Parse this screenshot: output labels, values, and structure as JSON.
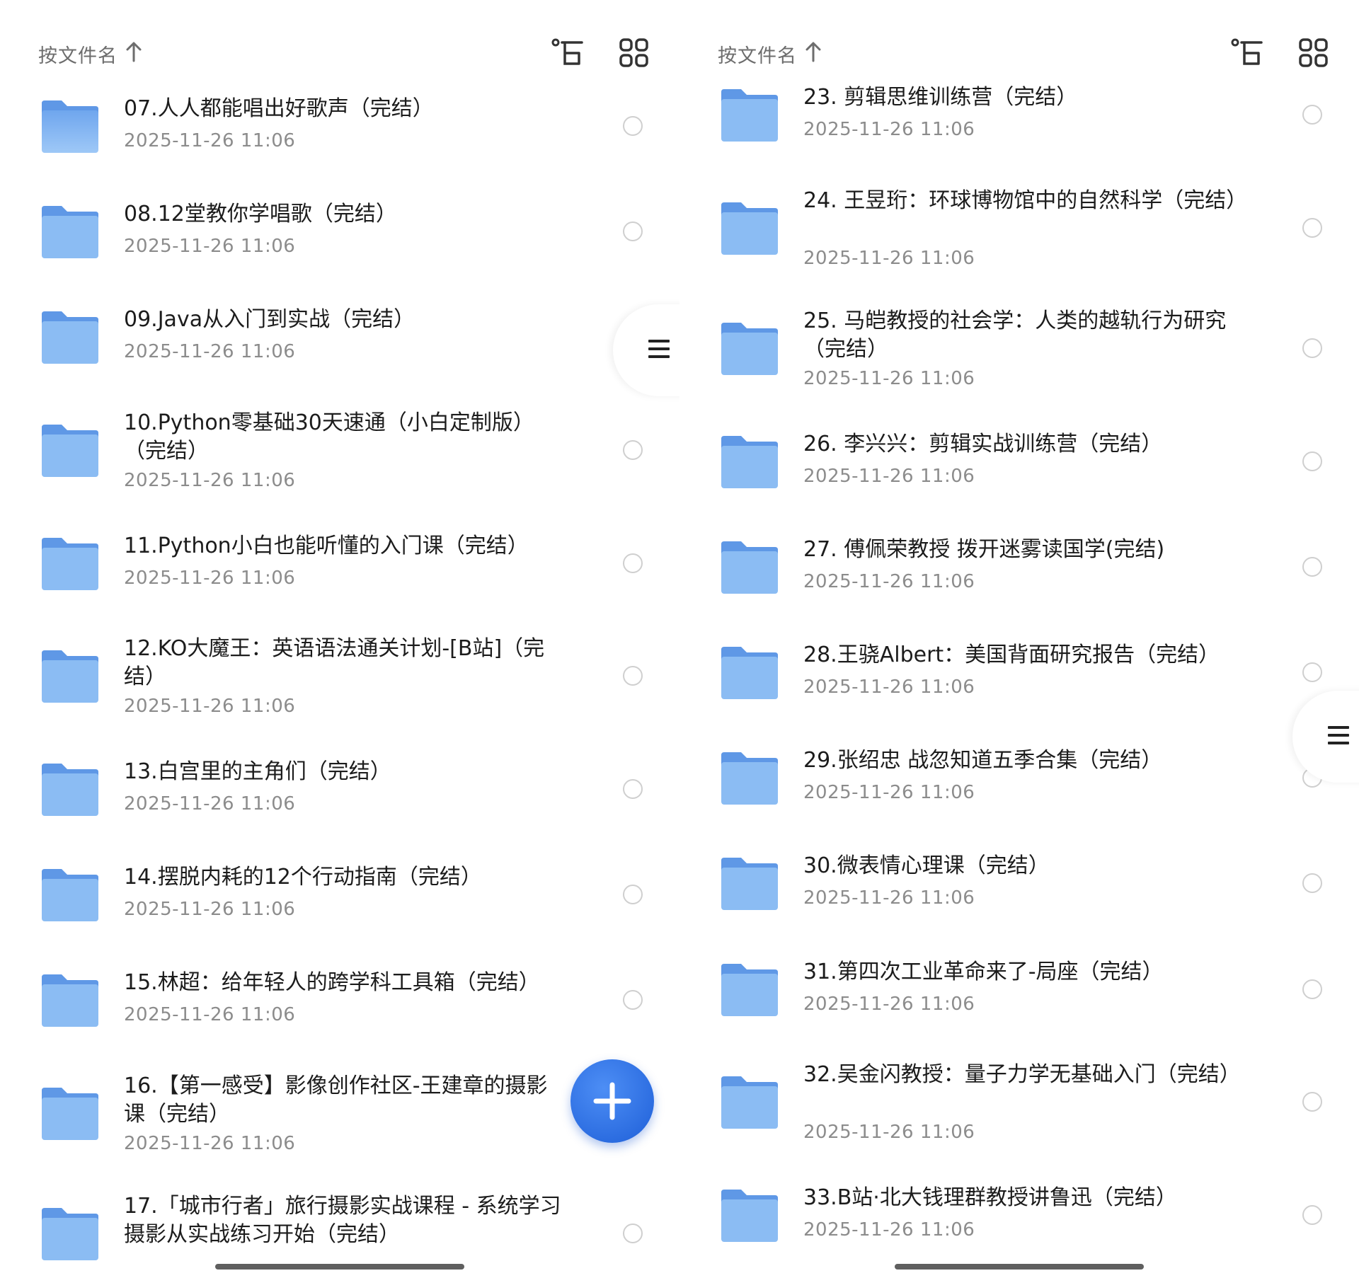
{
  "header": {
    "sort_label": "按文件名"
  },
  "left": {
    "items": [
      {
        "name": "07.人人都能唱出好歌声（完结）",
        "date": "2025-11-26 11:06"
      },
      {
        "name": "08.12堂教你学唱歌（完结）",
        "date": "2025-11-26 11:06"
      },
      {
        "name": "09.Java从入门到实战（完结）",
        "date": "2025-11-26 11:06"
      },
      {
        "name": "10.Python零基础30天速通（小白定制版）（完结）",
        "date": "2025-11-26 11:06"
      },
      {
        "name": "11.Python小白也能听懂的入门课（完结）",
        "date": "2025-11-26 11:06"
      },
      {
        "name": "12.KO大魔王：英语语法通关计划-[B站]（完结）",
        "date": "2025-11-26 11:06"
      },
      {
        "name": "13.白宫里的主角们（完结）",
        "date": "2025-11-26 11:06"
      },
      {
        "name": "14.摆脱内耗的12个行动指南（完结）",
        "date": "2025-11-26 11:06"
      },
      {
        "name": "15.林超：给年轻人的跨学科工具箱（完结）",
        "date": "2025-11-26 11:06"
      },
      {
        "name": "16.【第一感受】影像创作社区-王建章的摄影课（完结）",
        "date": "2025-11-26 11:06"
      },
      {
        "name": "17.「城市行者」旅行摄影实战课程 - 系统学习摄影从实战练习开始（完结）",
        "date": ""
      }
    ]
  },
  "right": {
    "items": [
      {
        "name": "23. 剪辑思维训练营（完结）",
        "date": "2025-11-26 11:06"
      },
      {
        "name": "24. 王昱珩：环球博物馆中的自然科学（完结）",
        "date": "2025-11-26 11:06"
      },
      {
        "name": "25. 马皑教授的社会学：人类的越轨行为研究（完结）",
        "date": "2025-11-26 11:06"
      },
      {
        "name": "26. 李兴兴：剪辑实战训练营（完结）",
        "date": "2025-11-26 11:06"
      },
      {
        "name": "27. 傅佩荣教授 拨开迷雾读国学(完结)",
        "date": "2025-11-26 11:06"
      },
      {
        "name": "28.王骁Albert：美国背面研究报告（完结）",
        "date": "2025-11-26 11:06"
      },
      {
        "name": "29.张绍忠 战忽知道五季合集（完结）",
        "date": "2025-11-26 11:06"
      },
      {
        "name": "30.微表情心理课（完结）",
        "date": "2025-11-26 11:06"
      },
      {
        "name": "31.第四次工业革命来了-局座（完结）",
        "date": "2025-11-26 11:06"
      },
      {
        "name": "32.吴金闪教授：量子力学无基础入门（完结）",
        "date": "2025-11-26 11:06"
      },
      {
        "name": "33.B站·北大钱理群教授讲鲁迅（完结）",
        "date": "2025-11-26 11:06"
      }
    ]
  },
  "icons": {
    "sort": "arrow-up-icon",
    "tree": "tree-view-icon",
    "grid": "grid-view-icon",
    "folder": "folder-icon",
    "fab": "plus-icon",
    "drawer": "menu-icon"
  },
  "colors": {
    "accent": "#2a6ee6",
    "folder": "#7fb2f0"
  }
}
